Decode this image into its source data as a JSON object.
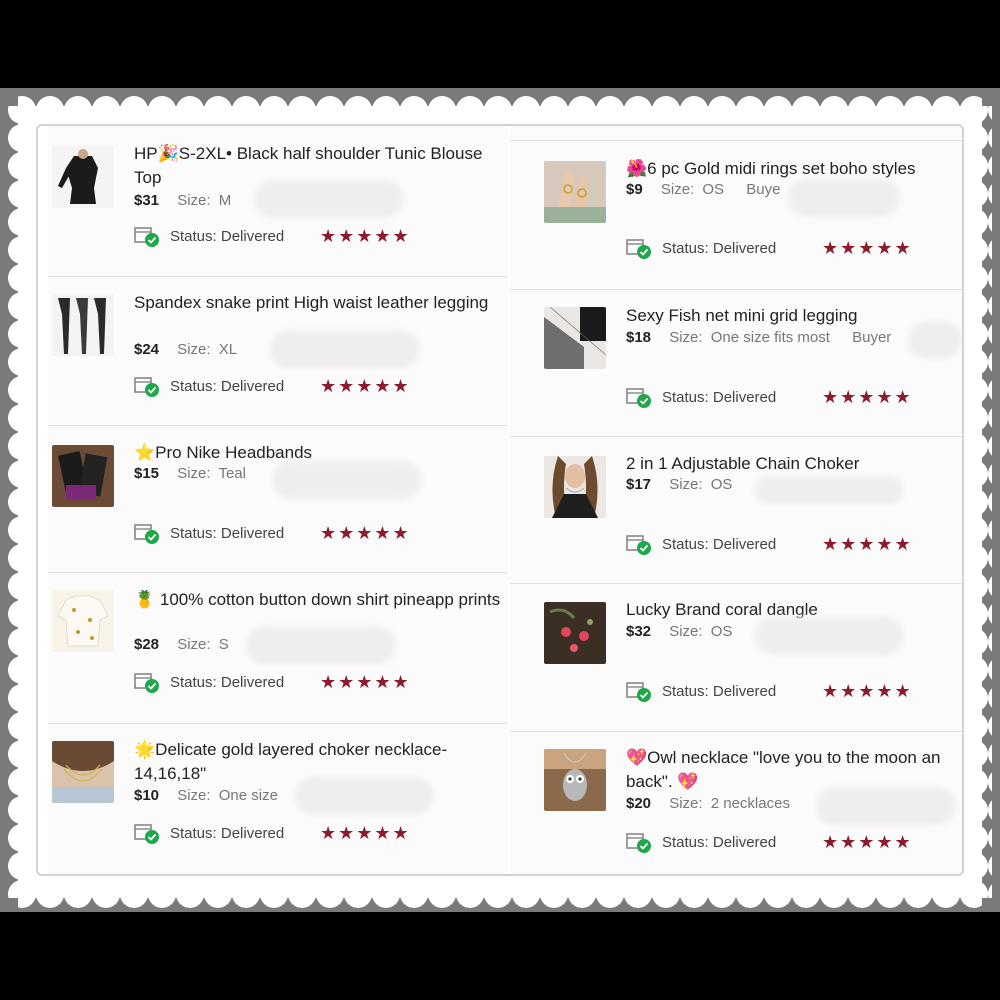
{
  "colors": {
    "star": "#8c1b2e",
    "check": "#1ea84a"
  },
  "status_label": "Status: ",
  "left": [
    {
      "emoji": "🎉",
      "title": "HP🎉S-2XL• Black half shoulder Tunic Blouse Top",
      "price": "$31",
      "size_label": "Size:",
      "size": "M",
      "status": "Delivered",
      "stars": "★★★★★",
      "thumb": "black-top-icon"
    },
    {
      "emoji": "",
      "title": "Spandex snake print High waist leather legging",
      "price": "$24",
      "size_label": "Size:",
      "size": "XL",
      "status": "Delivered",
      "stars": "★★★★★",
      "thumb": "leggings-icon"
    },
    {
      "emoji": "⭐",
      "title": "Pro Nike Headbands",
      "price": "$15",
      "size_label": "Size:",
      "size": "Teal",
      "status": "Delivered",
      "stars": "★★★★★",
      "thumb": "headbands-icon"
    },
    {
      "emoji": "🍍",
      "title": " 100% cotton button down shirt pineapp prints",
      "price": "$28",
      "size_label": "Size:",
      "size": "S",
      "status": "Delivered",
      "stars": "★★★★★",
      "thumb": "shirt-icon"
    },
    {
      "emoji": "🌟",
      "title": "Delicate gold layered choker necklace-14,16,18\"",
      "price": "$10",
      "size_label": "Size:",
      "size": "One size",
      "status": "Delivered",
      "stars": "★★★★★",
      "thumb": "necklace-icon"
    }
  ],
  "right": [
    {
      "emoji": "🌺",
      "title": "6 pc Gold midi rings set boho styles",
      "price": "$9",
      "size_label": "Size:",
      "size": "OS",
      "buyer": "Buye",
      "status": "Delivered",
      "stars": "★★★★★",
      "thumb": "rings-icon"
    },
    {
      "emoji": "",
      "title": "Sexy Fish net mini grid legging",
      "price": "$18",
      "size_label": "Size:",
      "size": "One size fits most",
      "buyer": "Buyer",
      "status": "Delivered",
      "stars": "★★★★★",
      "thumb": "fishnet-icon"
    },
    {
      "emoji": "",
      "title": "2 in 1 Adjustable Chain Choker",
      "price": "$17",
      "size_label": "Size:",
      "size": "OS",
      "buyer": "",
      "status": "Delivered",
      "stars": "★★★★★",
      "thumb": "choker-icon"
    },
    {
      "emoji": "",
      "title": "Lucky Brand coral dangle",
      "price": "$32",
      "size_label": "Size:",
      "size": "OS",
      "buyer": "",
      "status": "Delivered",
      "stars": "★★★★★",
      "thumb": "earrings-icon"
    },
    {
      "emoji": "💖",
      "title": "Owl necklace \"love you to the moon an back\". 💖",
      "price": "$20",
      "size_label": "Size:",
      "size": "2 necklaces",
      "buyer": "",
      "status": "Delivered",
      "stars": "★★★★★",
      "thumb": "owl-necklace-icon"
    }
  ]
}
